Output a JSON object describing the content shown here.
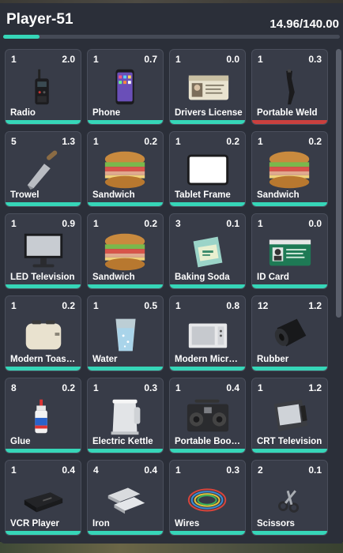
{
  "header": {
    "title": "Player-51",
    "weight_text": "14.96/140.00",
    "weight_fraction": 0.107
  },
  "colors": {
    "accent": "#36d6b8",
    "low": "#c9403e",
    "panel": "#2b2f39",
    "slot": "#383c48"
  },
  "items": [
    {
      "qty": "1",
      "weight": "2.0",
      "label": "Radio",
      "icon": "radio-icon",
      "durability": "full"
    },
    {
      "qty": "1",
      "weight": "0.7",
      "label": "Phone",
      "icon": "phone-icon",
      "durability": "full"
    },
    {
      "qty": "1",
      "weight": "0.0",
      "label": "Drivers License",
      "icon": "drivers-license-icon",
      "durability": "full"
    },
    {
      "qty": "1",
      "weight": "0.3",
      "label": "Portable Weld",
      "icon": "welder-icon",
      "durability": "low"
    },
    {
      "qty": "5",
      "weight": "1.3",
      "label": "Trowel",
      "icon": "trowel-icon",
      "durability": "full"
    },
    {
      "qty": "1",
      "weight": "0.2",
      "label": "Sandwich",
      "icon": "sandwich-icon",
      "durability": "full"
    },
    {
      "qty": "1",
      "weight": "0.2",
      "label": "Tablet Frame",
      "icon": "tablet-frame-icon",
      "durability": "full"
    },
    {
      "qty": "1",
      "weight": "0.2",
      "label": "Sandwich",
      "icon": "sandwich-icon",
      "durability": "full"
    },
    {
      "qty": "1",
      "weight": "0.9",
      "label": "LED Television",
      "icon": "television-icon",
      "durability": "full"
    },
    {
      "qty": "1",
      "weight": "0.2",
      "label": "Sandwich",
      "icon": "sandwich-icon",
      "durability": "full"
    },
    {
      "qty": "3",
      "weight": "0.1",
      "label": "Baking Soda",
      "icon": "baking-soda-icon",
      "durability": "full"
    },
    {
      "qty": "1",
      "weight": "0.0",
      "label": "ID Card",
      "icon": "id-card-icon",
      "durability": "full"
    },
    {
      "qty": "1",
      "weight": "0.2",
      "label": "Modern Toast…",
      "icon": "toaster-icon",
      "durability": "full"
    },
    {
      "qty": "1",
      "weight": "0.5",
      "label": "Water",
      "icon": "water-glass-icon",
      "durability": "full"
    },
    {
      "qty": "1",
      "weight": "0.8",
      "label": "Modern Micro…",
      "icon": "microwave-icon",
      "durability": "full"
    },
    {
      "qty": "12",
      "weight": "1.2",
      "label": "Rubber",
      "icon": "rubber-roll-icon",
      "durability": "full"
    },
    {
      "qty": "8",
      "weight": "0.2",
      "label": "Glue",
      "icon": "glue-bottle-icon",
      "durability": "full"
    },
    {
      "qty": "1",
      "weight": "0.3",
      "label": "Electric Kettle",
      "icon": "kettle-icon",
      "durability": "full"
    },
    {
      "qty": "1",
      "weight": "0.4",
      "label": "Portable Boo…",
      "icon": "boombox-icon",
      "durability": "full"
    },
    {
      "qty": "1",
      "weight": "1.2",
      "label": "CRT Television",
      "icon": "crt-tv-icon",
      "durability": "full"
    },
    {
      "qty": "1",
      "weight": "0.4",
      "label": "VCR Player",
      "icon": "vcr-icon",
      "durability": "full"
    },
    {
      "qty": "4",
      "weight": "0.4",
      "label": "Iron",
      "icon": "iron-bars-icon",
      "durability": "full"
    },
    {
      "qty": "1",
      "weight": "0.3",
      "label": "Wires",
      "icon": "wires-icon",
      "durability": "full"
    },
    {
      "qty": "2",
      "weight": "0.1",
      "label": "Scissors",
      "icon": "scissors-icon",
      "durability": "full"
    }
  ]
}
